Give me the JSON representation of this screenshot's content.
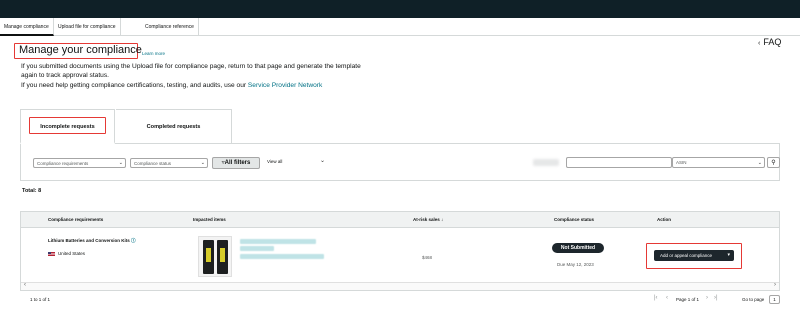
{
  "tabs": [
    {
      "label": "Manage compliance",
      "active": true
    },
    {
      "label": "Upload file for compliance",
      "active": false
    },
    {
      "label": "Compliance reference",
      "active": false
    }
  ],
  "header": {
    "title": "Manage your compliance",
    "learn_more": "Learn more",
    "faq": "FAQ",
    "faq_icon": "chevron-left-icon"
  },
  "intro": {
    "line1": "If you submitted documents using the Upload file for compliance page, return to that page and generate the template",
    "line2": "again to track approval status.",
    "line3_prefix": "If you need help getting compliance certifications, testing, and audits, use our ",
    "line3_link": "Service Provider Network"
  },
  "page_tabs": [
    {
      "label": "Incomplete requests",
      "active": true
    },
    {
      "label": "Completed requests",
      "active": false
    }
  ],
  "filters": {
    "requirements_select": "Compliance requirements",
    "status_select": "Compliance status",
    "all_filters": "All filters",
    "view_all": "View all",
    "search_category": "ASIN",
    "search_icon": "search-icon"
  },
  "total": "Total: 8",
  "table": {
    "headers": {
      "requirements": "Compliance requirements",
      "items": "Impacted items",
      "sales": "At-risk sales",
      "status": "Compliance status",
      "action": "Action"
    },
    "row": {
      "requirement": "Lithium Batteries and Conversion Kits",
      "region": "United States",
      "sales": "$468",
      "status": "Not Submitted",
      "due": "Due May 12, 2023",
      "action": "Add or appeal compliance"
    }
  },
  "footer": {
    "range": "1 to 1 of 1",
    "page": "Page 1 of 1",
    "goto_label": "Go to page",
    "goto_value": "1"
  },
  "colors": {
    "topbar": "#0f2027",
    "highlight": "#e53935",
    "link": "#007185",
    "dark_button": "#1d262c"
  }
}
